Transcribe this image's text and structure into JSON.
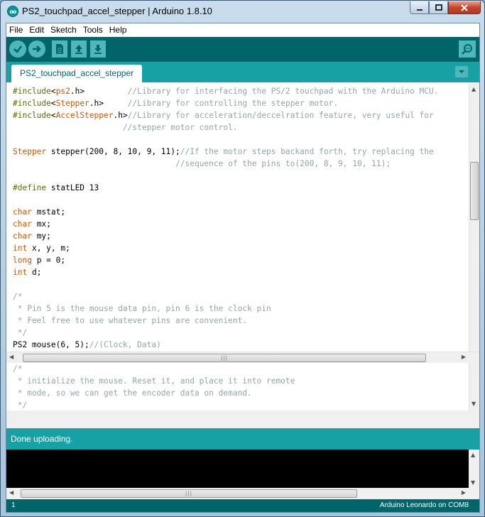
{
  "window": {
    "title": "PS2_touchpad_accel_stepper | Arduino 1.8.10",
    "app_icon_glyph": "oo"
  },
  "menubar": {
    "items": [
      "File",
      "Edit",
      "Sketch",
      "Tools",
      "Help"
    ]
  },
  "toolbar": {
    "buttons": [
      "verify-icon",
      "upload-icon",
      "new-file-icon",
      "open-icon",
      "save-icon"
    ],
    "serial_monitor_icon": "magnifier-icon"
  },
  "tabs": {
    "active": "PS2_touchpad_accel_stepper"
  },
  "editor": {
    "code_lines": [
      [
        [
          "dir",
          "#include"
        ],
        [
          "",
          "<"
        ],
        [
          "kw",
          "ps2"
        ],
        [
          "",
          ".h>         "
        ],
        [
          "cmt",
          "//Library for interfacing the PS/2 touchpad with the Arduino MCU."
        ]
      ],
      [
        [
          "dir",
          "#include"
        ],
        [
          "",
          "<"
        ],
        [
          "kw",
          "Stepper"
        ],
        [
          "",
          ".h>     "
        ],
        [
          "cmt",
          "//Library for controlling the stepper motor."
        ]
      ],
      [
        [
          "dir",
          "#include"
        ],
        [
          "",
          "<"
        ],
        [
          "kw",
          "AccelStepper"
        ],
        [
          "",
          ".h>"
        ],
        [
          "cmt",
          "//Library for acceleration/deccelration feature, very useful for"
        ]
      ],
      [
        [
          "",
          "                       "
        ],
        [
          "cmt",
          "//stepper motor control."
        ]
      ],
      [],
      [
        [
          "kw",
          "Stepper"
        ],
        [
          "",
          " stepper(200, 8, 10, 9, 11);"
        ],
        [
          "cmt",
          "//If the motor steps backand forth, try replacing the"
        ]
      ],
      [
        [
          "",
          "                                  "
        ],
        [
          "cmt",
          "//sequence of the pins to(200, 8, 9, 10, 11);"
        ]
      ],
      [],
      [
        [
          "dir",
          "#define"
        ],
        [
          "",
          ""
        ],
        [
          "",
          ""
        ],
        [
          "",
          " statLED 13"
        ]
      ],
      [],
      [
        [
          "kw",
          "char"
        ],
        [
          "",
          " mstat;"
        ]
      ],
      [
        [
          "kw",
          "char"
        ],
        [
          "",
          " mx;"
        ]
      ],
      [
        [
          "kw",
          "char"
        ],
        [
          "",
          " my;"
        ]
      ],
      [
        [
          "kw",
          "int"
        ],
        [
          "",
          " x, y, m;"
        ]
      ],
      [
        [
          "kw",
          "long"
        ],
        [
          "",
          " p = 0;"
        ]
      ],
      [
        [
          "kw",
          "int"
        ],
        [
          "",
          " d;"
        ]
      ],
      [],
      [
        [
          "cmt",
          "/*"
        ]
      ],
      [
        [
          "cmt",
          " * Pin 5 is the mouse data pin, pin 6 is the clock pin"
        ]
      ],
      [
        [
          "cmt",
          " * Feel free to use whatever pins are convenient."
        ]
      ],
      [
        [
          "cmt",
          " */"
        ]
      ],
      [
        [
          "",
          "PS2 mouse(6, 5);"
        ],
        [
          "cmt",
          "//(Clock, Data)"
        ]
      ],
      [],
      [
        [
          "cmt",
          "/*"
        ]
      ],
      [
        [
          "cmt",
          " * initialize the mouse. Reset it, and place it into remote"
        ]
      ],
      [
        [
          "cmt",
          " * mode, so we can get the encoder data on demand."
        ]
      ],
      [
        [
          "cmt",
          " */"
        ]
      ]
    ]
  },
  "status": {
    "message": "Done uploading."
  },
  "bottom_bar": {
    "line": "1",
    "board": "Arduino Leonardo on COM8"
  },
  "colors": {
    "teal_dark": "#006468",
    "teal": "#17a1a5",
    "teal_light": "#4db7bb",
    "keyword": "#d35400",
    "comment": "#95a5a6"
  }
}
